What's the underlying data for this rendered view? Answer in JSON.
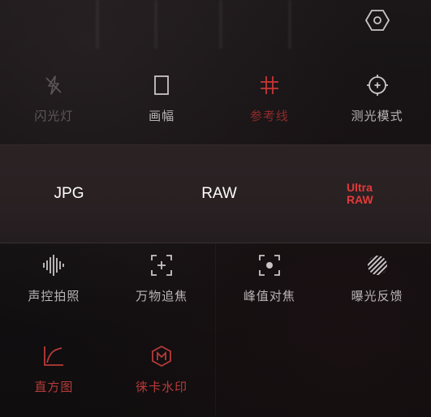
{
  "settings": {
    "icon": "settings-hexagon-icon"
  },
  "row1": [
    {
      "label": "闪光灯",
      "icon": "flash-off-icon",
      "state": "dim"
    },
    {
      "label": "画幅",
      "icon": "aspect-ratio-icon",
      "state": "normal"
    },
    {
      "label": "参考线",
      "icon": "grid-lines-icon",
      "state": "active"
    },
    {
      "label": "测光模式",
      "icon": "metering-mode-icon",
      "state": "normal"
    }
  ],
  "formats": {
    "jpg": "JPG",
    "raw": "RAW",
    "ultra_raw_line1": "Ultra",
    "ultra_raw_line2": "RAW",
    "active": "Ultra RAW"
  },
  "row3": [
    {
      "label": "声控拍照",
      "icon": "voice-waveform-icon"
    },
    {
      "label": "万物追焦",
      "icon": "focus-track-plus-icon"
    },
    {
      "label": "峰值对焦",
      "icon": "focus-peaking-icon"
    },
    {
      "label": "曝光反馈",
      "icon": "zebra-stripes-icon"
    }
  ],
  "row4": [
    {
      "label": "直方图",
      "icon": "histogram-curve-icon"
    },
    {
      "label": "徕卡水印",
      "icon": "m-badge-icon"
    }
  ],
  "colors": {
    "active_red": "#e23a3a",
    "dim_red": "#8e2b2b",
    "text": "#b9b4b6"
  }
}
